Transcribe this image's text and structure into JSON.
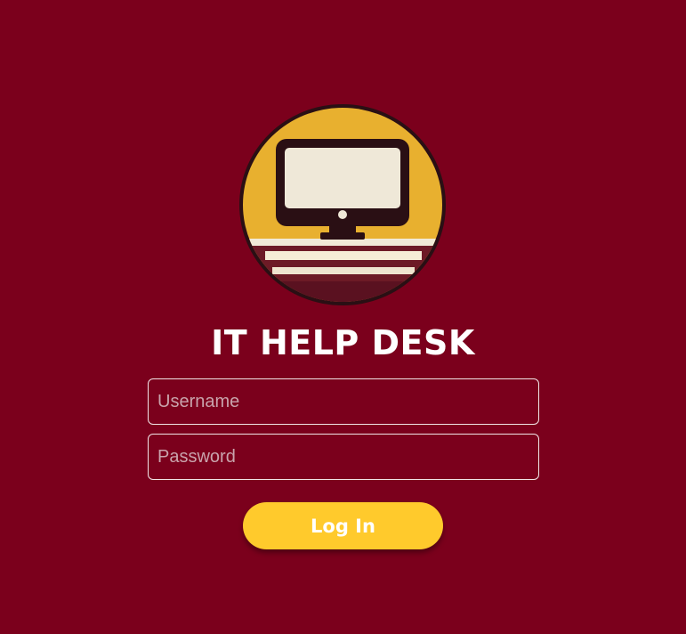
{
  "app": {
    "title": "IT HELP DESK"
  },
  "form": {
    "username": {
      "placeholder": "Username",
      "value": ""
    },
    "password": {
      "placeholder": "Password",
      "value": ""
    },
    "submit_label": "Log In"
  },
  "icons": {
    "logo": "computer-monitor-logo"
  },
  "colors": {
    "background": "#7b001c",
    "accent": "#ffca2c",
    "logo_gold": "#e8b02f",
    "text": "#ffffff"
  }
}
